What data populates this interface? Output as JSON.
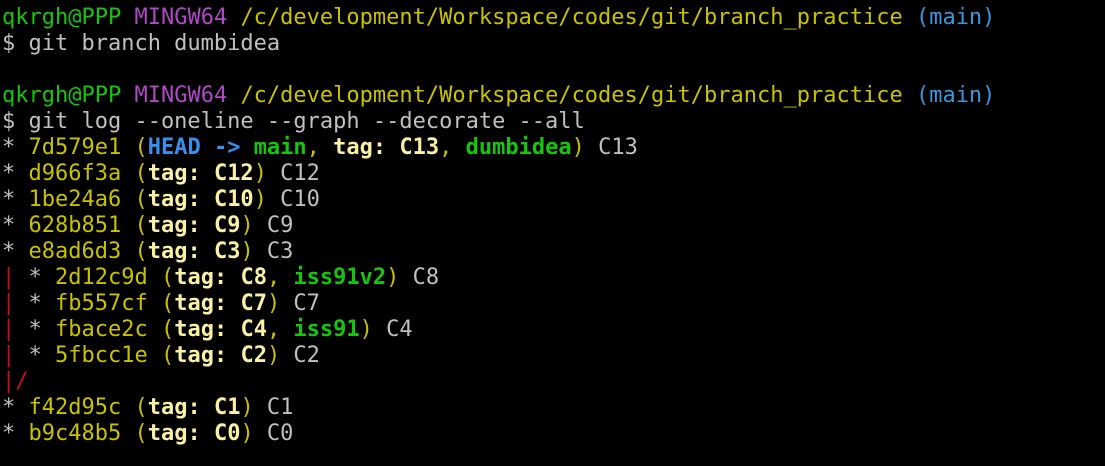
{
  "palette": {
    "default": "#c0c0c0",
    "prompt_user": "#16c60c",
    "prompt_shell": "#b148c6",
    "prompt_path": "#c9c200",
    "prompt_branch": "#3a96dd",
    "hash": "#c9c200",
    "head": "#3b8eea",
    "tag": "#f9f1a5",
    "branch": "#16c60c",
    "graph_branch": "#c50f1f"
  },
  "terminal": {
    "lines": [
      [
        {
          "t": "qkrgh@PPP",
          "c": "prompt_user"
        },
        {
          "t": " "
        },
        {
          "t": "MINGW64",
          "c": "prompt_shell"
        },
        {
          "t": " "
        },
        {
          "t": "/c/development/Workspace/codes/git/branch_practice",
          "c": "prompt_path"
        },
        {
          "t": " "
        },
        {
          "t": "(main)",
          "c": "prompt_branch"
        }
      ],
      [
        {
          "t": "$ git branch dumbidea"
        }
      ],
      [],
      [
        {
          "t": "qkrgh@PPP",
          "c": "prompt_user"
        },
        {
          "t": " "
        },
        {
          "t": "MINGW64",
          "c": "prompt_shell"
        },
        {
          "t": " "
        },
        {
          "t": "/c/development/Workspace/codes/git/branch_practice",
          "c": "prompt_path"
        },
        {
          "t": " "
        },
        {
          "t": "(main)",
          "c": "prompt_branch"
        }
      ],
      [
        {
          "t": "$ git log --oneline --graph --decorate --all"
        }
      ],
      [
        {
          "t": "* "
        },
        {
          "t": "7d579e1",
          "c": "hash"
        },
        {
          "t": " (",
          "c": "hash"
        },
        {
          "t": "HEAD -> ",
          "c": "head",
          "b": true
        },
        {
          "t": "main",
          "c": "branch",
          "b": true
        },
        {
          "t": ", ",
          "c": "hash"
        },
        {
          "t": "tag: C13",
          "c": "tag",
          "b": true
        },
        {
          "t": ", ",
          "c": "hash"
        },
        {
          "t": "dumbidea",
          "c": "branch",
          "b": true
        },
        {
          "t": ")",
          "c": "hash"
        },
        {
          "t": " C13"
        }
      ],
      [
        {
          "t": "* "
        },
        {
          "t": "d966f3a",
          "c": "hash"
        },
        {
          "t": " (",
          "c": "hash"
        },
        {
          "t": "tag: C12",
          "c": "tag",
          "b": true
        },
        {
          "t": ")",
          "c": "hash"
        },
        {
          "t": " C12"
        }
      ],
      [
        {
          "t": "* "
        },
        {
          "t": "1be24a6",
          "c": "hash"
        },
        {
          "t": " (",
          "c": "hash"
        },
        {
          "t": "tag: C10",
          "c": "tag",
          "b": true
        },
        {
          "t": ")",
          "c": "hash"
        },
        {
          "t": " C10"
        }
      ],
      [
        {
          "t": "* "
        },
        {
          "t": "628b851",
          "c": "hash"
        },
        {
          "t": " (",
          "c": "hash"
        },
        {
          "t": "tag: C9",
          "c": "tag",
          "b": true
        },
        {
          "t": ")",
          "c": "hash"
        },
        {
          "t": " C9"
        }
      ],
      [
        {
          "t": "* "
        },
        {
          "t": "e8ad6d3",
          "c": "hash"
        },
        {
          "t": " (",
          "c": "hash"
        },
        {
          "t": "tag: C3",
          "c": "tag",
          "b": true
        },
        {
          "t": ")",
          "c": "hash"
        },
        {
          "t": " C3"
        }
      ],
      [
        {
          "t": "|",
          "c": "graph_branch"
        },
        {
          "t": " * "
        },
        {
          "t": "2d12c9d",
          "c": "hash"
        },
        {
          "t": " (",
          "c": "hash"
        },
        {
          "t": "tag: C8",
          "c": "tag",
          "b": true
        },
        {
          "t": ", ",
          "c": "hash"
        },
        {
          "t": "iss91v2",
          "c": "branch",
          "b": true
        },
        {
          "t": ")",
          "c": "hash"
        },
        {
          "t": " C8"
        }
      ],
      [
        {
          "t": "|",
          "c": "graph_branch"
        },
        {
          "t": " * "
        },
        {
          "t": "fb557cf",
          "c": "hash"
        },
        {
          "t": " (",
          "c": "hash"
        },
        {
          "t": "tag: C7",
          "c": "tag",
          "b": true
        },
        {
          "t": ")",
          "c": "hash"
        },
        {
          "t": " C7"
        }
      ],
      [
        {
          "t": "|",
          "c": "graph_branch"
        },
        {
          "t": " * "
        },
        {
          "t": "fbace2c",
          "c": "hash"
        },
        {
          "t": " (",
          "c": "hash"
        },
        {
          "t": "tag: C4",
          "c": "tag",
          "b": true
        },
        {
          "t": ", ",
          "c": "hash"
        },
        {
          "t": "iss91",
          "c": "branch",
          "b": true
        },
        {
          "t": ")",
          "c": "hash"
        },
        {
          "t": " C4"
        }
      ],
      [
        {
          "t": "|",
          "c": "graph_branch"
        },
        {
          "t": " * "
        },
        {
          "t": "5fbcc1e",
          "c": "hash"
        },
        {
          "t": " (",
          "c": "hash"
        },
        {
          "t": "tag: C2",
          "c": "tag",
          "b": true
        },
        {
          "t": ")",
          "c": "hash"
        },
        {
          "t": " C2"
        }
      ],
      [
        {
          "t": "|/",
          "c": "graph_branch"
        }
      ],
      [
        {
          "t": "* "
        },
        {
          "t": "f42d95c",
          "c": "hash"
        },
        {
          "t": " (",
          "c": "hash"
        },
        {
          "t": "tag: C1",
          "c": "tag",
          "b": true
        },
        {
          "t": ")",
          "c": "hash"
        },
        {
          "t": " C1"
        }
      ],
      [
        {
          "t": "* "
        },
        {
          "t": "b9c48b5",
          "c": "hash"
        },
        {
          "t": " (",
          "c": "hash"
        },
        {
          "t": "tag: C0",
          "c": "tag",
          "b": true
        },
        {
          "t": ")",
          "c": "hash"
        },
        {
          "t": " C0"
        }
      ]
    ]
  }
}
